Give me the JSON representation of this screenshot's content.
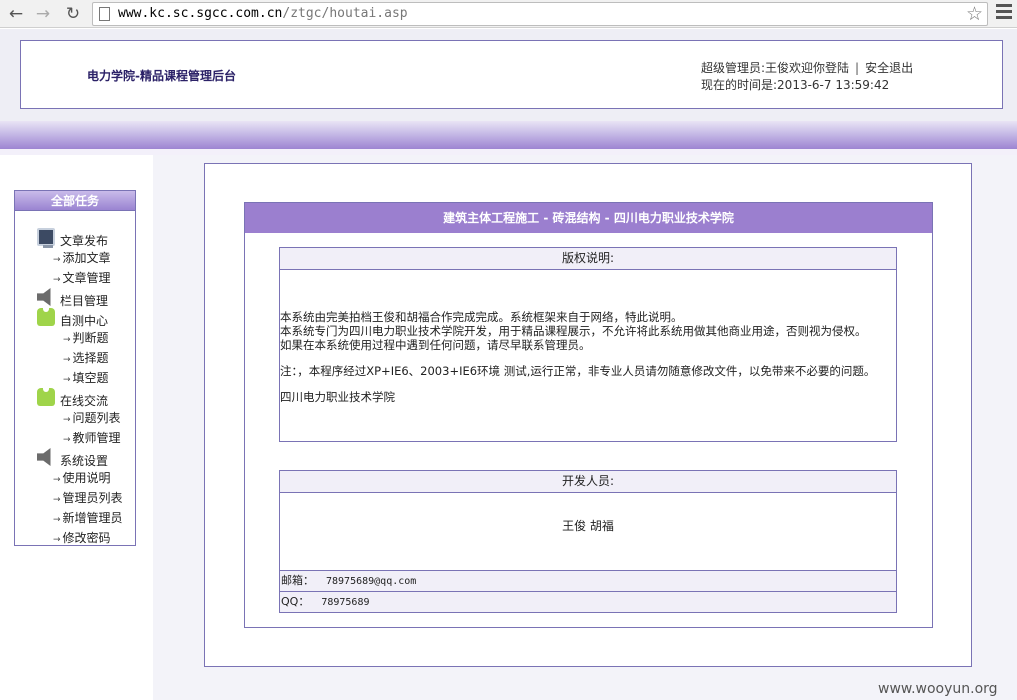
{
  "browser": {
    "url_host": "www.kc.sc.sgcc.com.cn",
    "url_path": "/ztgc/houtai.asp"
  },
  "header": {
    "site_title": "电力学院-精品课程管理后台",
    "admin_greeting": "超级管理员:王俊欢迎你登陆",
    "separator": "|",
    "logout": "安全退出",
    "time_label": "现在的时间是:",
    "time_value": "2013-6-7 13:59:42"
  },
  "sidebar": {
    "title": "全部任务",
    "groups": [
      {
        "label": "文章发布",
        "icon": "computer-icon",
        "items": [
          "添加文章",
          "文章管理"
        ]
      },
      {
        "label": "栏目管理",
        "icon": "speaker-icon",
        "items": []
      },
      {
        "label": "自测中心",
        "icon": "shirt-icon",
        "items": [
          "判断题",
          "选择题",
          "填空题"
        ]
      },
      {
        "label": "在线交流",
        "icon": "shirt-icon",
        "items": [
          "问题列表",
          "教师管理"
        ]
      },
      {
        "label": "系统设置",
        "icon": "speaker-icon",
        "items": [
          "使用说明",
          "管理员列表",
          "新增管理员",
          "修改密码"
        ]
      }
    ]
  },
  "main": {
    "title": "建筑主体工程施工 - 砖混结构 - 四川电力职业技术学院",
    "copyright": {
      "heading": "版权说明:",
      "lines": [
        "本系统由完美拍档王俊和胡福合作完成完成。系统框架来自于网络，特此说明。",
        "本系统专门为四川电力职业技术学院开发，用于精品课程展示，不允许将此系统用做其他商业用途，否则视为侵权。",
        "如果在本系统使用过程中遇到任何问题，请尽早联系管理员。",
        "注：，本程序经过XP+IE6、2003+IE6环境 测试,运行正常，非专业人员请勿随意修改文件，以免带来不必要的问题。",
        "四川电力职业技术学院"
      ]
    },
    "developers": {
      "heading": "开发人员:",
      "names": "王俊  胡福",
      "email_label": "邮箱：",
      "email": "78975689@qq.com",
      "qq_label": "QQ：",
      "qq": "78975689"
    }
  },
  "watermark": "www.wooyun.org"
}
